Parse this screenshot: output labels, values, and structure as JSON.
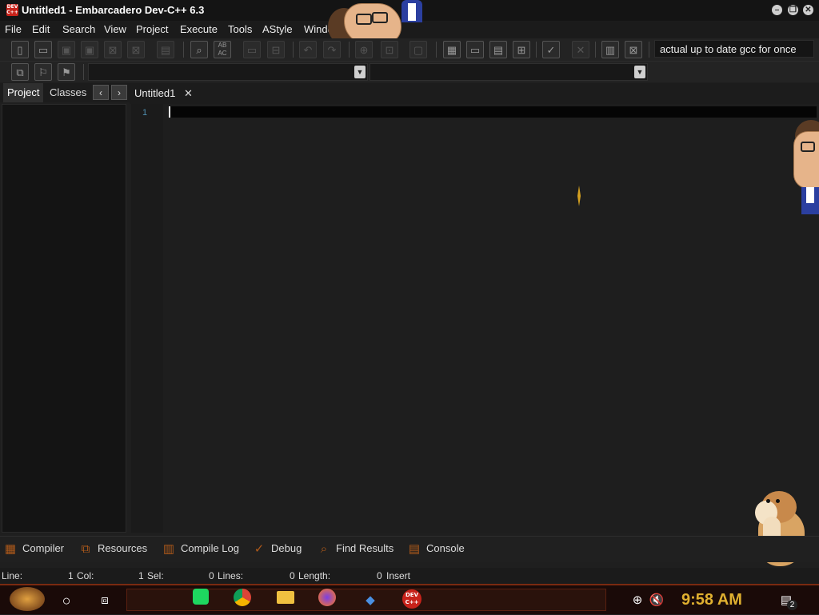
{
  "window": {
    "title": "Untitled1 - Embarcadero Dev-C++ 6.3",
    "app_icon_text": "DEV C++"
  },
  "menu": [
    "File",
    "Edit",
    "Search",
    "View",
    "Project",
    "Execute",
    "Tools",
    "AStyle",
    "Windo"
  ],
  "toolbar": {
    "compiler_selected": "actual up to date gcc for once",
    "icons": [
      "new-file-icon",
      "open-icon",
      "save-icon",
      "save-all-icon",
      "close-icon",
      "close-all-icon",
      "print-icon",
      "find-icon",
      "replace-icon",
      "indent-icon",
      "unindent-icon",
      "undo-icon",
      "redo-icon",
      "insert-icon",
      "goto-icon",
      "comment-icon",
      "grid-4-icon",
      "window-icon",
      "calendar-icon",
      "tile-icon",
      "check-icon",
      "x-icon",
      "chart-icon",
      "compile-run-icon"
    ]
  },
  "left_panel": {
    "tabs": [
      "Project",
      "Classes"
    ],
    "active_tab": "Project",
    "prev_label": "‹",
    "next_label": "›"
  },
  "editor": {
    "tabs": [
      {
        "label": "Untitled1",
        "active": true
      }
    ],
    "line_numbers": [
      "1"
    ],
    "content": ""
  },
  "bottom_tabs": [
    "Compiler",
    "Resources",
    "Compile Log",
    "Debug",
    "Find Results",
    "Console"
  ],
  "status": {
    "line_label": "Line:",
    "line_value": "1",
    "col_label": "Col:",
    "col_value": "1",
    "sel_label": "Sel:",
    "sel_value": "0",
    "lines_label": "Lines:",
    "lines_value": "0",
    "length_label": "Length:",
    "length_value": "0",
    "mode": "Insert"
  },
  "taskbar": {
    "apps": [
      "start-icon",
      "cortana-icon",
      "task-view-icon",
      "spotify-icon",
      "chrome-icon",
      "file-explorer-icon",
      "firefox-icon",
      "cube-icon",
      "devcpp-icon"
    ],
    "devcpp_label": "DEV C++",
    "clock": "9:58 AM",
    "notification_count": "2"
  },
  "colors": {
    "accent": "#e0b030",
    "taskbar_border": "#7a2a10",
    "line_number": "#4f8fb0"
  }
}
